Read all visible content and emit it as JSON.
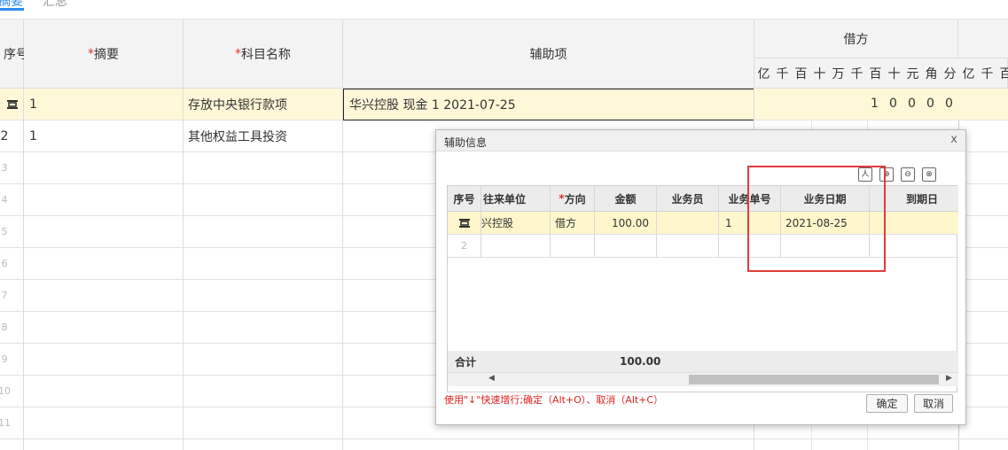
{
  "tabs": {
    "active": "摘要",
    "second": "汇总"
  },
  "grid": {
    "headers": {
      "seq": "序号",
      "summary": "摘要",
      "account": "科目名称",
      "aux": "辅助项",
      "debit": "借方"
    },
    "digit_units": [
      "亿",
      "千",
      "百",
      "十",
      "万",
      "千",
      "百",
      "十",
      "元",
      "角",
      "分",
      "亿",
      "千",
      "百"
    ],
    "rows": [
      {
        "no": "",
        "summary": "1",
        "account": "存放中央银行款项",
        "aux": "华兴控股 现金 1 2021-07-25",
        "amount_digits": [
          "1",
          "0",
          "0",
          "0",
          "0"
        ]
      },
      {
        "no": "2",
        "summary": "1",
        "account": "其他权益工具投资",
        "aux": ""
      },
      {
        "no": "3"
      },
      {
        "no": "4"
      },
      {
        "no": "5"
      },
      {
        "no": "6"
      },
      {
        "no": "7"
      },
      {
        "no": "8"
      },
      {
        "no": "9"
      },
      {
        "no": "10"
      },
      {
        "no": "11"
      }
    ]
  },
  "dialog": {
    "title": "辅助信息",
    "close": "x",
    "tools": [
      "人",
      "⊕",
      "⊖",
      "⊗"
    ],
    "columns": [
      "序号",
      "往来单位",
      "方向",
      "金额",
      "业务员",
      "业务单号",
      "业务日期",
      "",
      "到期日"
    ],
    "rows": [
      {
        "no": "",
        "unit": "兴控股",
        "direction": "借方",
        "amount": "100.00",
        "staff": "",
        "biz_no": "1",
        "biz_date": "2021-08-25",
        "due": ""
      },
      {
        "no": "2",
        "unit": "",
        "direction": "",
        "amount": "",
        "staff": "",
        "biz_no": "",
        "biz_date": "",
        "due": ""
      }
    ],
    "sum_label": "合计",
    "sum_value": "100.00",
    "hint": "使用\"↓\"快速增行;确定（Alt+O）、取消（Alt+C）",
    "ok": "确定",
    "cancel": "取消"
  },
  "colors": {
    "accent": "#2d8cf0",
    "selected_row": "#fff8d8",
    "highlight_box": "#e03c3c",
    "required": "#e03030"
  }
}
